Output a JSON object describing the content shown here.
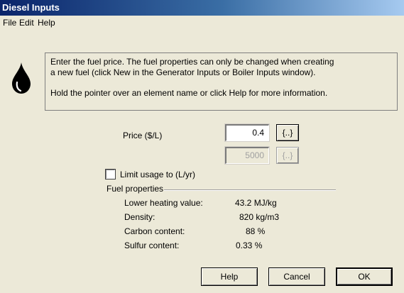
{
  "window": {
    "title": "Diesel Inputs"
  },
  "menu": {
    "items": [
      "File",
      "Edit",
      "Help"
    ]
  },
  "info": {
    "line1": "Enter the fuel price. The fuel properties can only be changed when creating",
    "line2": "a new fuel (click New in the Generator Inputs or Boiler Inputs window).",
    "line3": "Hold the pointer over an element name or click Help for more information."
  },
  "price": {
    "label": "Price ($/L)",
    "value": "0.4",
    "button": "{..}"
  },
  "limit": {
    "label": "Limit usage to (L/yr)",
    "value": "5000",
    "button": "{..}",
    "checked": false
  },
  "fuel_properties": {
    "heading": "Fuel properties",
    "rows": [
      {
        "label": "Lower heating value:",
        "value": "43.2 MJ/kg"
      },
      {
        "label": "Density:",
        "value": "820 kg/m3"
      },
      {
        "label": "Carbon content:",
        "value": "88 %"
      },
      {
        "label": "Sulfur content:",
        "value": "0.33 %"
      }
    ]
  },
  "buttons": {
    "help": "Help",
    "cancel": "Cancel",
    "ok": "OK"
  },
  "icons": {
    "fuel": "fuel-drop-icon"
  }
}
